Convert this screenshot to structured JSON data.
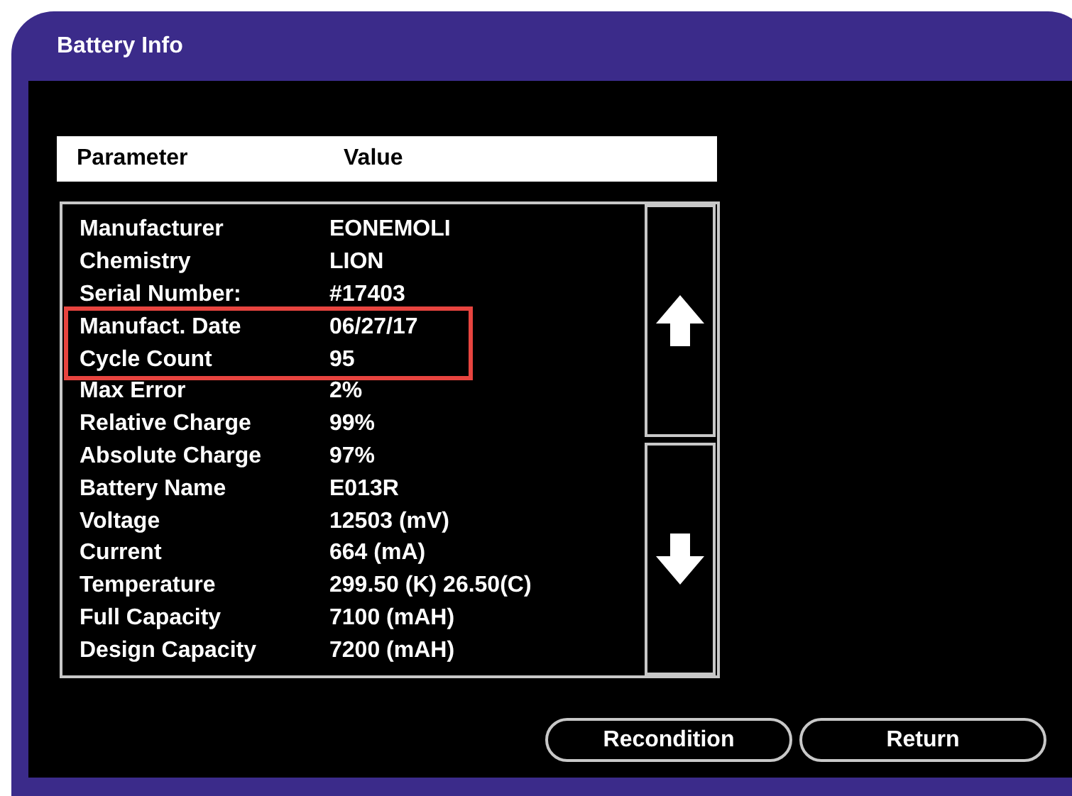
{
  "window": {
    "title": "Battery Info"
  },
  "table": {
    "columns": [
      "Parameter",
      "Value"
    ],
    "rows": [
      {
        "parameter": "Manufacturer",
        "value": "EONEMOLI",
        "highlighted": false
      },
      {
        "parameter": "Chemistry",
        "value": "LION",
        "highlighted": false
      },
      {
        "parameter": "Serial Number:",
        "value": "#17403",
        "highlighted": false
      },
      {
        "parameter": "Manufact. Date",
        "value": "06/27/17",
        "highlighted": true
      },
      {
        "parameter": "Cycle Count",
        "value": "95",
        "highlighted": true
      },
      {
        "parameter": "Max Error",
        "value": "2%",
        "highlighted": false
      },
      {
        "parameter": "Relative Charge",
        "value": "99%",
        "highlighted": false
      },
      {
        "parameter": "Absolute Charge",
        "value": "97%",
        "highlighted": false
      },
      {
        "parameter": "Battery Name",
        "value": "E013R",
        "highlighted": false
      },
      {
        "parameter": "Voltage",
        "value": "12503 (mV)",
        "highlighted": false
      },
      {
        "parameter": "Current",
        "value": "664 (mA)",
        "highlighted": false
      },
      {
        "parameter": "Temperature",
        "value": "299.50 (K) 26.50(C)",
        "highlighted": false
      },
      {
        "parameter": "Full Capacity",
        "value": "7100 (mAH)",
        "highlighted": false
      },
      {
        "parameter": "Design Capacity",
        "value": "7200 (mAH)",
        "highlighted": false
      }
    ]
  },
  "buttons": [
    "Recondition",
    "Return"
  ]
}
